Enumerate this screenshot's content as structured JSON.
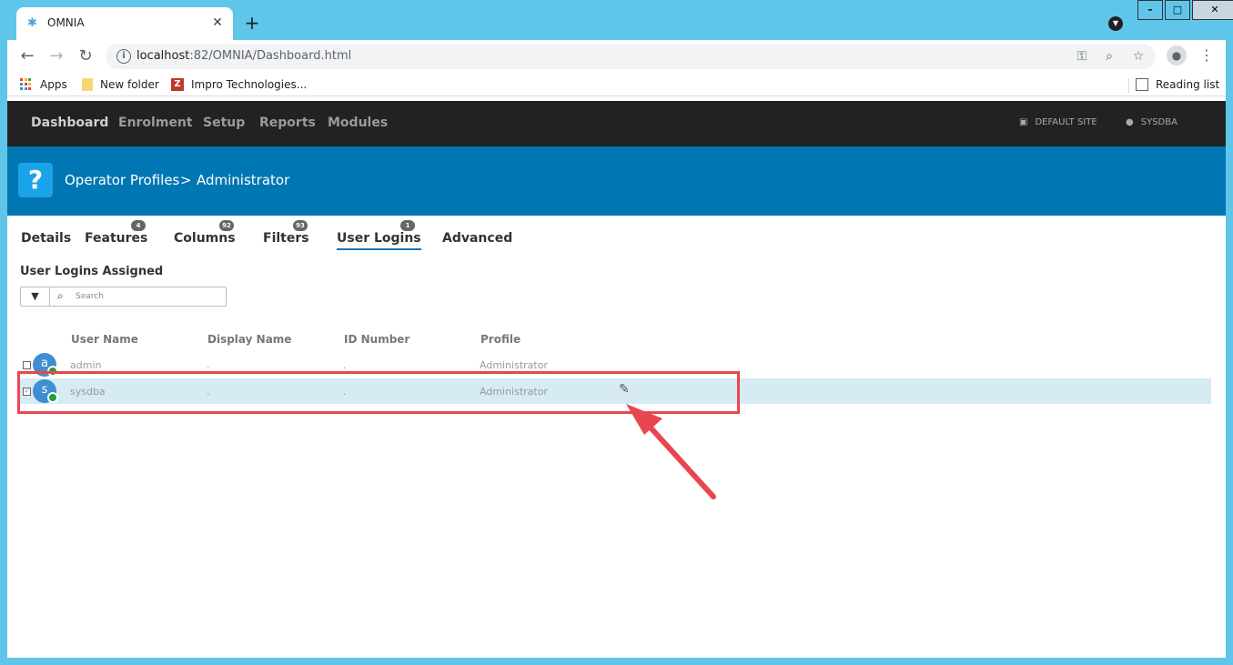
{
  "browser": {
    "tab_title": "OMNIA",
    "url_host": "localhost",
    "url_rest": ":82/OMNIA/Dashboard.html",
    "bookmarks": [
      "Apps",
      "New folder",
      "Impro Technologies..."
    ],
    "reading_list": "Reading list"
  },
  "app_nav": {
    "items": [
      "Dashboard",
      "Enrolment",
      "Setup",
      "Reports",
      "Modules"
    ],
    "site": "DEFAULT SITE",
    "user": "SYSDBA"
  },
  "banner": {
    "icon": "?",
    "crumb_parent": "Operator Profiles",
    "crumb_sep": ">",
    "crumb_current": "Administrator"
  },
  "profile_tabs": [
    {
      "label": "Details",
      "badge": ""
    },
    {
      "label": "Features",
      "badge": "4"
    },
    {
      "label": "Columns",
      "badge": "92"
    },
    {
      "label": "Filters",
      "badge": "93"
    },
    {
      "label": "User Logins",
      "badge": "1"
    },
    {
      "label": "Advanced",
      "badge": ""
    }
  ],
  "section": {
    "title": "User Logins Assigned",
    "search_placeholder": "Search"
  },
  "table": {
    "headers": [
      "User Name",
      "Display Name",
      "ID Number",
      "Profile"
    ],
    "rows": [
      {
        "initial": "a",
        "user": "admin",
        "display": ".",
        "id": ".",
        "profile": "Administrator"
      },
      {
        "initial": "s",
        "user": "sysdba",
        "display": ".",
        "id": ".",
        "profile": "Administrator"
      }
    ]
  },
  "colors": {
    "banner": "#0077b3",
    "nav_bg": "#222222",
    "selected_row": "#d6ebf2",
    "annotation": "#e8474f"
  }
}
